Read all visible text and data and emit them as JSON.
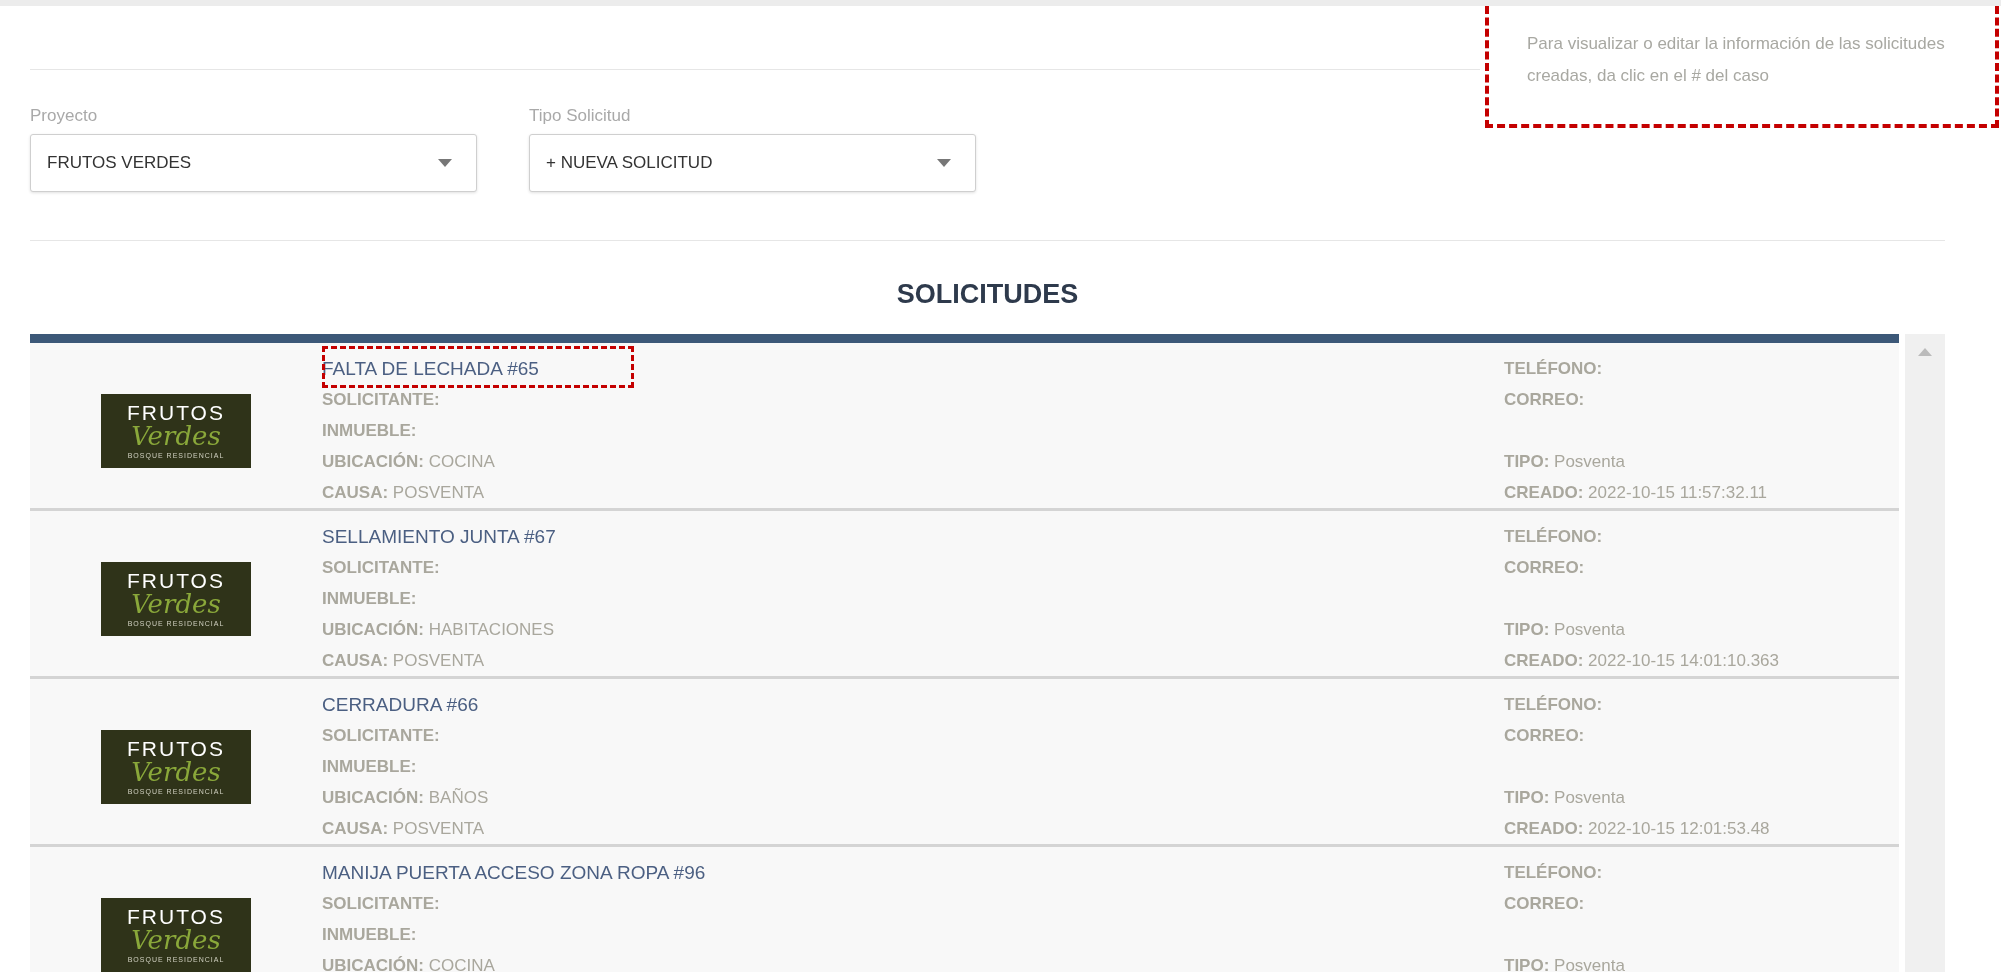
{
  "hint": {
    "text": "Para visualizar o editar la información de las solicitudes creadas, da clic en el # del caso"
  },
  "filters": [
    {
      "label": "Proyecto",
      "value": "FRUTOS VERDES"
    },
    {
      "label": "Tipo Solicitud",
      "value": "+ NUEVA SOLICITUD"
    }
  ],
  "list": {
    "title": "SOLICITUDES",
    "rows": [
      {
        "highlighted": true,
        "logo": {
          "line1": "FRUTOS",
          "line2": "Verdes",
          "line3": "BOSQUE RESIDENCIAL"
        },
        "title": "FALTA DE LECHADA #65",
        "left": [
          {
            "label": "SOLICITANTE:"
          },
          {
            "label": "INMUEBLE:"
          },
          {
            "label": "UBICACIÓN:",
            "value": "COCINA"
          },
          {
            "label": "CAUSA:",
            "value": "POSVENTA"
          }
        ],
        "contact": [
          {
            "label": "TELÉFONO:"
          },
          {
            "label": "CORREO:"
          }
        ],
        "meta": [
          {
            "label": "TIPO:",
            "value": "Posventa"
          },
          {
            "label": "CREADO:",
            "value": "2022-10-15 11:57:32.11"
          }
        ]
      },
      {
        "highlighted": false,
        "logo": {
          "line1": "FRUTOS",
          "line2": "Verdes",
          "line3": "BOSQUE RESIDENCIAL"
        },
        "title": "SELLAMIENTO JUNTA #67",
        "left": [
          {
            "label": "SOLICITANTE:"
          },
          {
            "label": "INMUEBLE:"
          },
          {
            "label": "UBICACIÓN:",
            "value": "HABITACIONES"
          },
          {
            "label": "CAUSA:",
            "value": "POSVENTA"
          }
        ],
        "contact": [
          {
            "label": "TELÉFONO:"
          },
          {
            "label": "CORREO:"
          }
        ],
        "meta": [
          {
            "label": "TIPO:",
            "value": "Posventa"
          },
          {
            "label": "CREADO:",
            "value": "2022-10-15 14:01:10.363"
          }
        ]
      },
      {
        "highlighted": false,
        "logo": {
          "line1": "FRUTOS",
          "line2": "Verdes",
          "line3": "BOSQUE RESIDENCIAL"
        },
        "title": "CERRADURA #66",
        "left": [
          {
            "label": "SOLICITANTE:"
          },
          {
            "label": "INMUEBLE:"
          },
          {
            "label": "UBICACIÓN:",
            "value": "BAÑOS"
          },
          {
            "label": "CAUSA:",
            "value": "POSVENTA"
          }
        ],
        "contact": [
          {
            "label": "TELÉFONO:"
          },
          {
            "label": "CORREO:"
          }
        ],
        "meta": [
          {
            "label": "TIPO:",
            "value": "Posventa"
          },
          {
            "label": "CREADO:",
            "value": "2022-10-15 12:01:53.48"
          }
        ]
      },
      {
        "highlighted": false,
        "logo": {
          "line1": "FRUTOS",
          "line2": "Verdes",
          "line3": "BOSQUE RESIDENCIAL"
        },
        "title": "MANIJA PUERTA ACCESO ZONA ROPA #96",
        "left": [
          {
            "label": "SOLICITANTE:"
          },
          {
            "label": "INMUEBLE:"
          },
          {
            "label": "UBICACIÓN:",
            "value": "COCINA"
          }
        ],
        "contact": [
          {
            "label": "TELÉFONO:"
          },
          {
            "label": "CORREO:"
          }
        ],
        "meta": [
          {
            "label": "TIPO:",
            "value": "Posventa"
          }
        ]
      }
    ]
  }
}
